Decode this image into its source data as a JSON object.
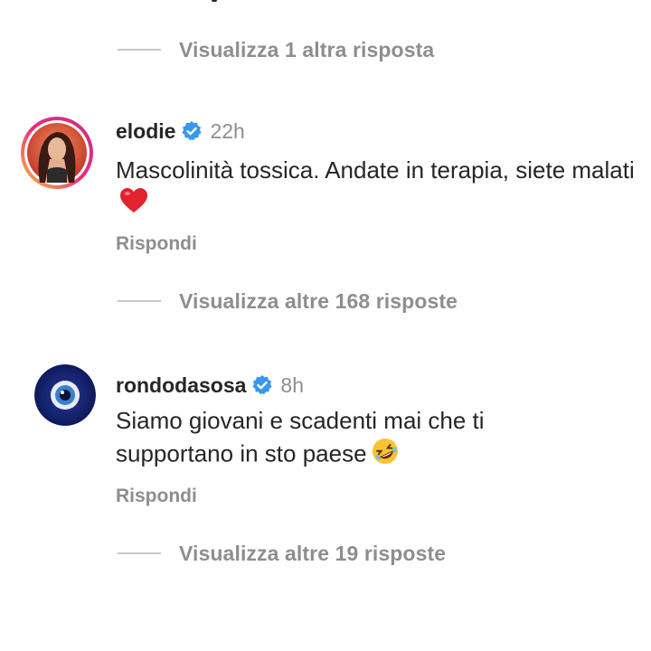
{
  "view_more_1": {
    "label": "Visualizza 1 altra risposta"
  },
  "comments": [
    {
      "username": "elodie",
      "verified": true,
      "timestamp": "22h",
      "text": "Mascolinità tossica. Andate in terapia, siete malati",
      "emoji": "red-heart-emoji",
      "reply_label": "Rispondi",
      "avatar_ring": true,
      "view_replies_label": "Visualizza altre 168 risposte"
    },
    {
      "username": "rondodasosa",
      "verified": true,
      "timestamp": "8h",
      "text": "Siamo giovani e scadenti mai che ti supportano in sto paese",
      "emoji": "rolling-on-floor-laughing-emoji",
      "reply_label": "Rispondi",
      "avatar_ring": false,
      "view_replies_label": "Visualizza altre 19 risposte"
    }
  ],
  "colors": {
    "text_primary": "#262626",
    "text_secondary": "#8e8e8e",
    "verified_blue": "#3897f0",
    "divider": "#c7c7c7"
  }
}
